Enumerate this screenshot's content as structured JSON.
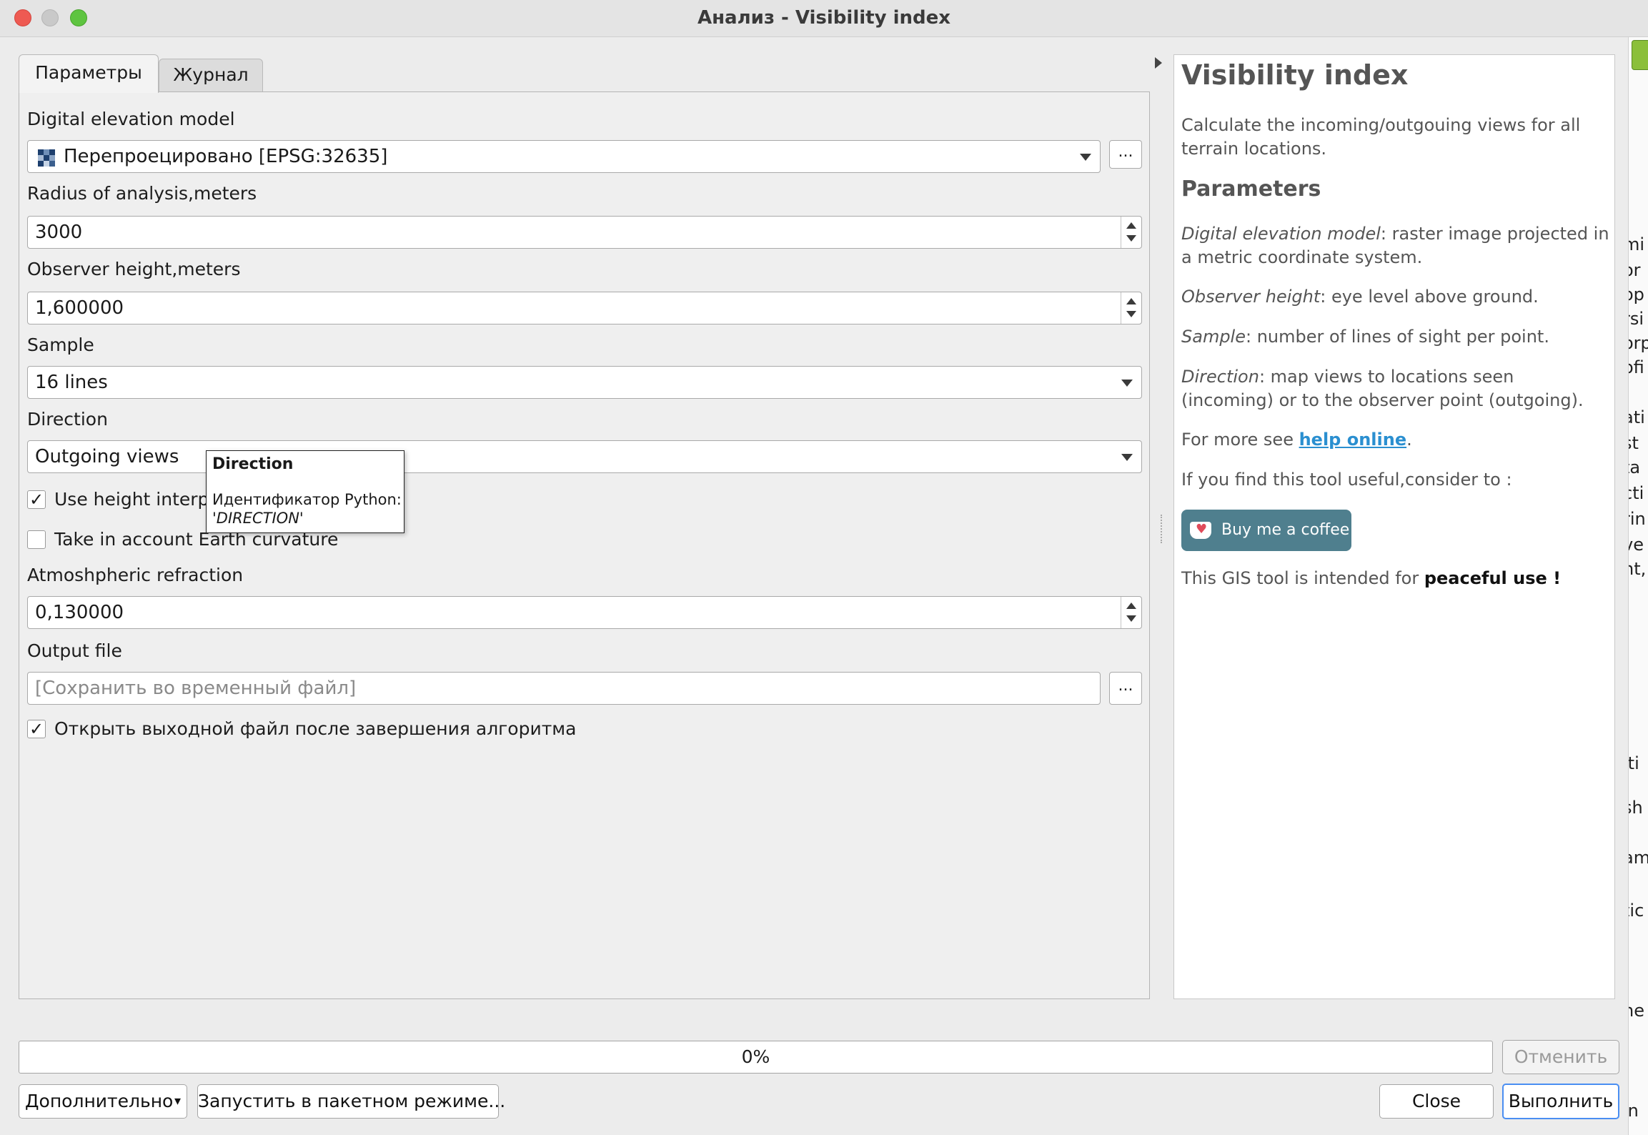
{
  "window": {
    "title": "Анализ - Visibility index"
  },
  "tabs": [
    {
      "label": "Параметры",
      "active": true
    },
    {
      "label": "Журнал",
      "active": false
    }
  ],
  "params": {
    "dem": {
      "label": "Digital elevation model",
      "value": "Перепроецировано [EPSG:32635]",
      "browse": "..."
    },
    "radius": {
      "label": "Radius of analysis,meters",
      "value": "3000"
    },
    "observer": {
      "label": "Observer height,meters",
      "value": "1,600000"
    },
    "sample": {
      "label": "Sample",
      "value": "16 lines"
    },
    "direction": {
      "label": "Direction",
      "value": "Outgoing views"
    },
    "use_height": {
      "label": "Use height interpolation",
      "visible_label": "Use height interp",
      "checked": true,
      "check_glyph": "✓"
    },
    "curvature": {
      "label": "Take in account Earth curvature",
      "checked": false
    },
    "refraction": {
      "label": "Atmoshpheric refraction",
      "value": "0,130000"
    },
    "output": {
      "label": "Output file",
      "placeholder": "[Сохранить во временный файл]",
      "browse": "..."
    },
    "open_output": {
      "label": "Открыть выходной файл после завершения алгоритма",
      "checked": true,
      "check_glyph": "✓"
    }
  },
  "tooltip": {
    "title": "Direction",
    "line1": "Идентификатор Python:",
    "line2": "'DIRECTION'"
  },
  "help": {
    "title": "Visibility index",
    "intro": "Calculate the incoming/outgouing views for all terrain locations.",
    "params_heading": "Parameters",
    "dem_term": "Digital elevation model",
    "dem_desc": ": raster image projected in a metric coordinate system.",
    "obs_term": "Observer height",
    "obs_desc": ": eye level above ground.",
    "sample_term": "Sample",
    "sample_desc": ": number of lines of sight per point.",
    "dir_term": "Direction",
    "dir_desc": ": map views to locations seen (incoming) or to the observer point (outgoing).",
    "more_prefix": "For more see ",
    "more_link": "help online",
    "more_suffix": ".",
    "useful": "If you find this tool useful,consider to :",
    "coffee": "Buy me a coffee",
    "peace_prefix": "This GIS tool is intended for ",
    "peace_bold": "peaceful use !"
  },
  "bottom": {
    "progress": "0%",
    "progress_value": 0,
    "cancel": "Отменить",
    "advanced": "Дополнительно",
    "advanced_arrow": "▾",
    "batch": "Запустить в пакетном режиме...",
    "close": "Close",
    "run": "Выполнить"
  },
  "background_peek": [
    "mi",
    "or",
    "op",
    "rsi",
    "orp",
    "ofi",
    "ati",
    "st",
    "ta",
    "cti",
    "rin",
    "ve",
    "nt,",
    "iti",
    "sh",
    "am",
    "tic",
    "ne",
    "in"
  ],
  "colors": {
    "link": "#2a8fd0",
    "accent": "#4a8ef2",
    "coffee_bg": "#4f7f8e"
  }
}
